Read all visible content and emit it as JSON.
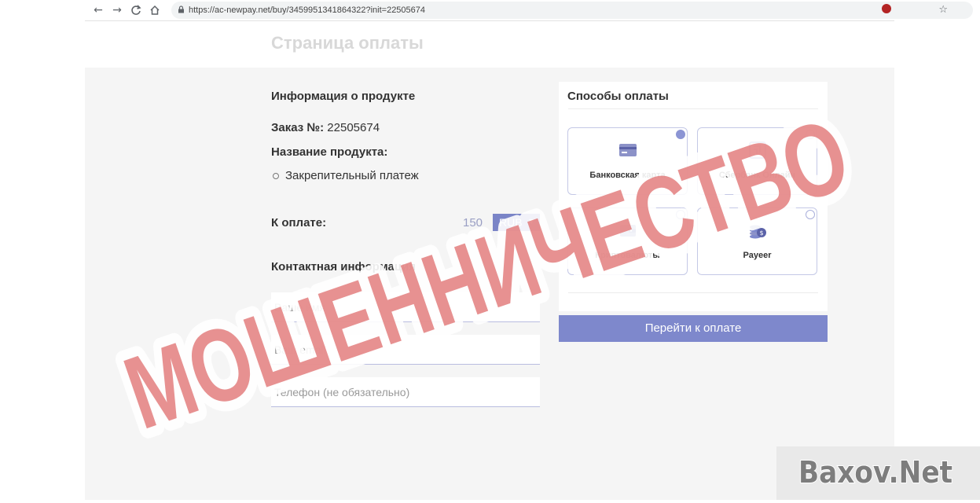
{
  "browser": {
    "back_glyph": "←",
    "forward_glyph": "→",
    "reload_glyph": "C",
    "home_glyph": "⌂",
    "lock_glyph": "🔒",
    "url": "https://ac-newpay.net/buy/3459951341864322?init=22505674",
    "star_glyph": "☆"
  },
  "page": {
    "title": "Страница оплаты"
  },
  "product": {
    "heading": "Информация о продукте",
    "order_label": "Заказ №:",
    "order_number": "22505674",
    "name_label": "Название продукта:",
    "item": "Закрепительный платеж",
    "amount_label": "К оплате:",
    "amount": "150",
    "currency": "RUB",
    "currency_caret": "▼"
  },
  "contact": {
    "heading": "Контактная информация",
    "name_placeholder": "Ваше имя",
    "email_placeholder": "Ваш email",
    "phone_placeholder": "Телефон (не обязательно)"
  },
  "payment": {
    "heading": "Способы оплаты",
    "methods": [
      {
        "label": "Банковская карта",
        "icon": "bank-card-icon",
        "selected": true
      },
      {
        "label": "Сбербанк Онлайн",
        "icon": "sberbank-icon",
        "selected": false
      },
      {
        "label": "Криптовалюты",
        "icon": "crypto-wallet-icon",
        "selected": false
      },
      {
        "label": "Payeer",
        "icon": "coins-icon",
        "selected": false
      }
    ],
    "submit_label": "Перейти к оплате"
  },
  "stamp": {
    "text": "МОШЕННИЧЕСТВО",
    "color": "#e07272"
  },
  "watermark": {
    "text": "Baxov.Net"
  },
  "colors": {
    "accent": "#7e88cc",
    "panel_bg": "#f5f5f5"
  }
}
